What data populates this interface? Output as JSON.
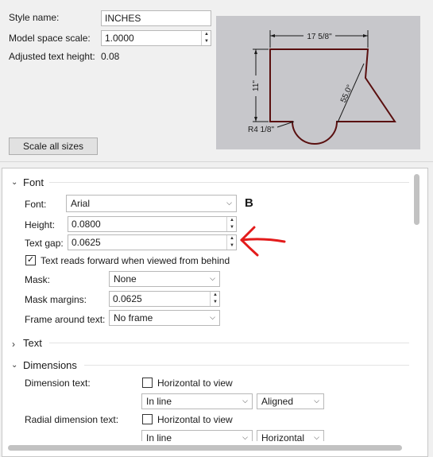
{
  "style": {
    "name_label": "Style name:",
    "name_value": "INCHES",
    "scale_label": "Model space scale:",
    "scale_value": "1.0000",
    "adjusted_label": "Adjusted text height:",
    "adjusted_value": "0.08",
    "scale_all_button": "Scale all sizes"
  },
  "preview": {
    "dim_width": "17 5/8\"",
    "dim_height": "11\"",
    "dim_angle": "55.0°",
    "dim_radius": "R4 1/8\""
  },
  "font_section": {
    "title": "Font",
    "font_label": "Font:",
    "font_value": "Arial",
    "bold_marker": "B",
    "height_label": "Height:",
    "height_value": "0.0800",
    "gap_label": "Text gap:",
    "gap_value": "0.0625",
    "reads_forward_label": "Text reads forward when viewed from behind",
    "reads_forward_checked": "✓",
    "mask_label": "Mask:",
    "mask_value": "None",
    "mask_margins_label": "Mask margins:",
    "mask_margins_value": "0.0625",
    "frame_label": "Frame around text:",
    "frame_value": "No frame"
  },
  "text_section": {
    "title": "Text"
  },
  "dimensions_section": {
    "title": "Dimensions",
    "dim_text_label": "Dimension text:",
    "horizontal_to_view": "Horizontal to view",
    "dim_text_position": "In line",
    "dim_text_orientation": "Aligned",
    "radial_label": "Radial dimension text:",
    "radial_horizontal_to_view": "Horizontal to view",
    "radial_position": "In line",
    "radial_orientation": "Horizontal"
  },
  "colors": {
    "accent_red": "#e31b1b",
    "preview_bg": "#c7c7cb",
    "drawing": "#5a0f0f"
  }
}
